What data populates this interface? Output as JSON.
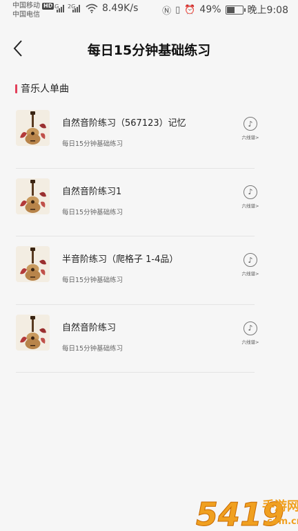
{
  "status_bar": {
    "carrier1": "中国移动",
    "hd": "HD",
    "carrier2": "中国电信",
    "net1": "4G",
    "net2": "2G",
    "speed": "8.49K/s",
    "battery": "49%",
    "time": "晚上9:08",
    "icons": [
      "nfc-icon",
      "vibrate-icon",
      "alarm-icon",
      "battery-icon",
      "wifi-icon",
      "signal-icon"
    ]
  },
  "header": {
    "back_icon": "back-arrow-icon",
    "title": "每日15分钟基础练习"
  },
  "section": {
    "title": "音乐人单曲",
    "accent_color": "#e2405a"
  },
  "items": [
    {
      "title": "自然音阶练习（567123）记忆",
      "subtitle": "每日15分钟基础练习",
      "action_label": "六线谱>",
      "icon": "music-note-icon"
    },
    {
      "title": "自然音阶练习1",
      "subtitle": "每日15分钟基础练习",
      "action_label": "六线谱>",
      "icon": "music-note-icon"
    },
    {
      "title": "半音阶练习（爬格子 1-4品）",
      "subtitle": "每日15分钟基础练习",
      "action_label": "六线谱>",
      "icon": "music-note-icon"
    },
    {
      "title": "自然音阶练习",
      "subtitle": "每日15分钟基础练习",
      "action_label": "六线谱>",
      "icon": "music-note-icon"
    }
  ],
  "watermark": {
    "text": "5419",
    "subtext": "手游网",
    "domain": ".com.cn"
  }
}
